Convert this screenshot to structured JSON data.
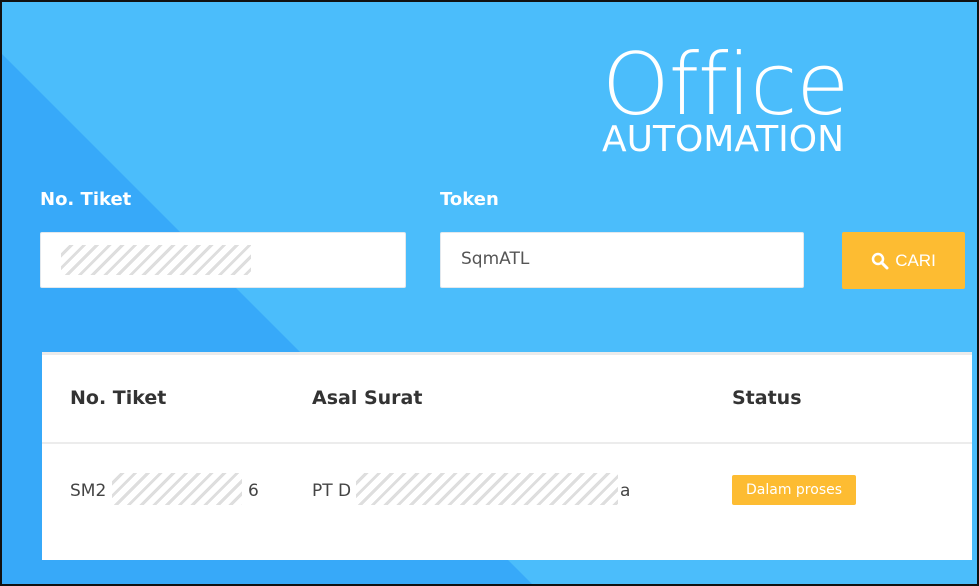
{
  "logo": {
    "main": "Office",
    "sub": "AUTOMATION"
  },
  "form": {
    "ticket_label": "No. Tiket",
    "ticket_value": "",
    "token_label": "Token",
    "token_value": "SqmATL",
    "search_button": "CARI"
  },
  "table": {
    "headers": [
      "No. Tiket",
      "Asal Surat",
      "Status"
    ],
    "rows": [
      {
        "ticket_start": "SM2",
        "ticket_end": "6",
        "origin_start": "PT D",
        "origin_end": "a",
        "status": "Dalam proses"
      }
    ]
  },
  "colors": {
    "background": "#4bbdfb",
    "accent": "#fdbc32"
  }
}
